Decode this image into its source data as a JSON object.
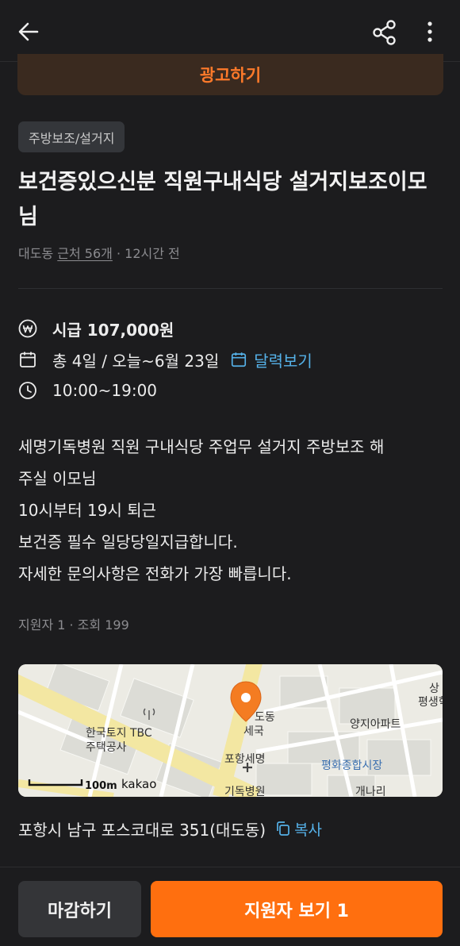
{
  "header": {
    "back_icon": "arrow-left-icon",
    "share_icon": "share-icon",
    "more_icon": "more-vertical-icon"
  },
  "ad_button": {
    "label": "광고하기"
  },
  "post": {
    "category": "주방보조/설거지",
    "title": "보건증있으신분 직원구내식당 설거지보조이모님",
    "meta": {
      "location": "대도동",
      "near_label": "근처 56개",
      "time": "· 12시간 전"
    },
    "wage": {
      "icon": "won-icon",
      "text": "시급 107,000원"
    },
    "schedule": {
      "icon": "calendar-icon",
      "text": "총 4일 / 오늘~6월 23일",
      "calendar_link": "달력보기"
    },
    "hours": {
      "icon": "clock-icon",
      "text": "10:00~19:00"
    },
    "description": [
      "세명기독병원 직원 구내식당 주업무 설거지 주방보조 해",
      "주실 이모님",
      "10시부터 19시 퇴근",
      "보건증 필수 일당당일지급합니다.",
      "자세한 문의사항은 전화가 가장 빠릅니다."
    ],
    "stats": "지원자 1 · 조회 199"
  },
  "map": {
    "labels": {
      "hanguk": "한국토지 TBC",
      "housing": "주택공사",
      "dodong": "도동",
      "sebuk": "세국",
      "pohang": "포항세명",
      "gidok": "기독병원",
      "yangji": "양지아파트",
      "market": "평화종합시장",
      "gaenari": "개나리",
      "sang": "상",
      "pyeongsaeng": "평생학",
      "scale": "100m",
      "brand": "kakao"
    },
    "colors": {
      "road": "#f3e7a2",
      "land": "#ecebe4",
      "block": "#dcdcd6",
      "pin": "#f47c22"
    }
  },
  "address": {
    "text": "포항시 남구 포스코대로 351(대도동)",
    "copy_label": "복사"
  },
  "bottom": {
    "close_label": "마감하기",
    "apply_label": "지원자 보기 1"
  },
  "colors": {
    "accent": "#ff6f0f",
    "link": "#55b1e8",
    "background": "#1c1c1e"
  }
}
